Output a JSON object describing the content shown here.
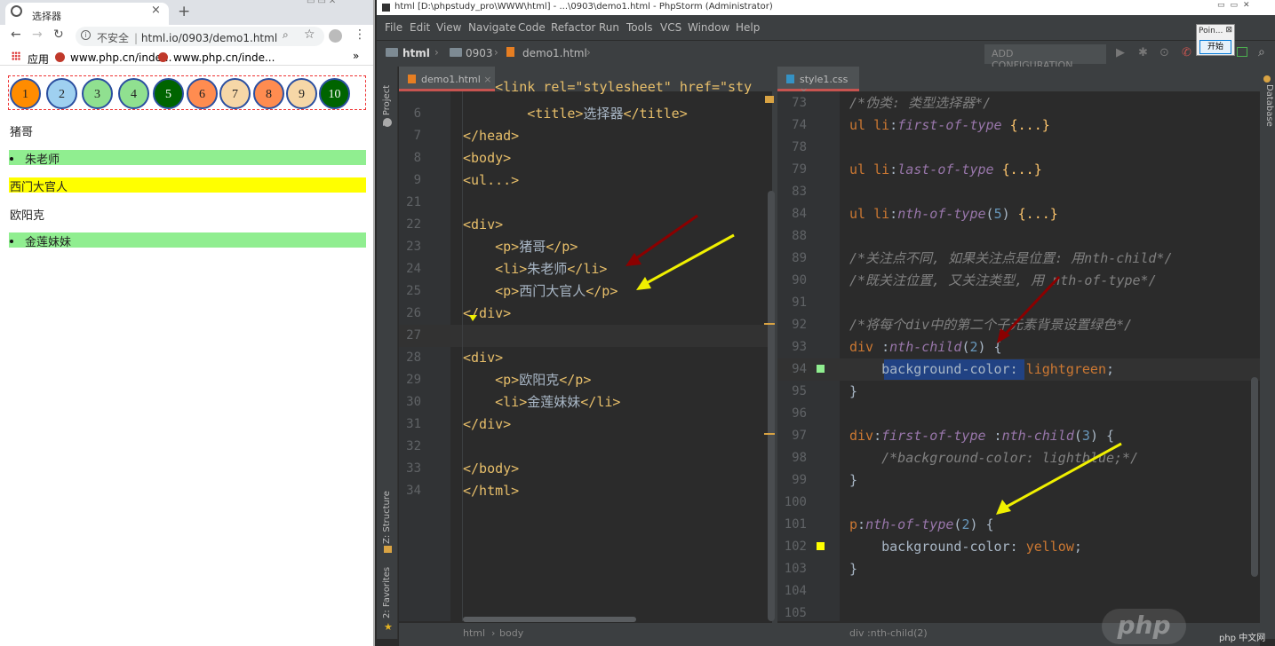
{
  "browser": {
    "tab_title": "选择器",
    "tab_close": "×",
    "new_tab": "+",
    "address_insecure": "不安全",
    "address_url": "html.io/0903/demo1.html",
    "bookmarks": [
      "应用",
      "www.php.cn/inde...",
      "www.php.cn/inde..."
    ],
    "bookmarks_more": "»",
    "circles": [
      {
        "label": "1",
        "bg": "#ff8c00"
      },
      {
        "label": "2",
        "bg": "#9fd0f0"
      },
      {
        "label": "3",
        "bg": "#90e090"
      },
      {
        "label": "4",
        "bg": "#90e090"
      },
      {
        "label": "5",
        "bg": "#006400"
      },
      {
        "label": "6",
        "bg": "#ff8c50"
      },
      {
        "label": "7",
        "bg": "#f6d7a7"
      },
      {
        "label": "8",
        "bg": "#ff8c50"
      },
      {
        "label": "9",
        "bg": "#f6d7a7"
      },
      {
        "label": "10",
        "bg": "#006400"
      }
    ],
    "paragraphs": [
      {
        "text": "猪哥",
        "bg": "",
        "bullet": false
      },
      {
        "text": "朱老师",
        "bg": "#90ee90",
        "bullet": true
      },
      {
        "text": "西门大官人",
        "bg": "#ffff00",
        "bullet": false
      },
      {
        "text": "欧阳克",
        "bg": "",
        "bullet": false
      },
      {
        "text": "金莲妹妹",
        "bg": "#90ee90",
        "bullet": true
      }
    ]
  },
  "ide": {
    "window_title": "html [D:\\phpstudy_pro\\WWW\\html] - ...\\0903\\demo1.html - PhpStorm (Administrator)",
    "menu": [
      "File",
      "Edit",
      "View",
      "Navigate",
      "Code",
      "Refactor",
      "Run",
      "Tools",
      "VCS",
      "Window",
      "Help"
    ],
    "breadcrumb": [
      "html",
      "0903",
      "demo1.html"
    ],
    "add_configuration": "ADD CONFIGURATION...",
    "left_tools": [
      "1: Project",
      "Z: Structure",
      "2: Favorites"
    ],
    "right_tool": "Database",
    "tab1": "demo1.html",
    "tab2": "style1.css",
    "popup_title": "Poin...",
    "popup_button": "开始",
    "status_left": [
      "html",
      "body"
    ],
    "status_right": "div :nth-child(2)",
    "watermark": "php",
    "watermark_small": "php 中文网"
  },
  "editor1_lines": [
    {
      "ln": "6",
      "html": "        <span class='tg'>&lt;title&gt;</span>选择器<span class='tg'>&lt;/title&gt;</span>"
    },
    {
      "ln": "7",
      "html": "<span class='tg'>&lt;/head&gt;</span>"
    },
    {
      "ln": "8",
      "html": "<span class='tg'>&lt;body&gt;</span>"
    },
    {
      "ln": "9",
      "html": "<span class='tg'>&lt;ul...&gt;</span>"
    },
    {
      "ln": "21",
      "html": ""
    },
    {
      "ln": "22",
      "html": "<span class='tg'>&lt;div&gt;</span>"
    },
    {
      "ln": "23",
      "html": "    <span class='tg'>&lt;p&gt;</span>猪哥<span class='tg'>&lt;/p&gt;</span>"
    },
    {
      "ln": "24",
      "html": "    <span class='tg'>&lt;li&gt;</span>朱老师<span class='tg'>&lt;/li&gt;</span>"
    },
    {
      "ln": "25",
      "html": "    <span class='tg'>&lt;p&gt;</span>西门大官人<span class='tg'>&lt;/p&gt;</span>"
    },
    {
      "ln": "26",
      "html": "<span class='tg'>&lt;/div&gt;</span>"
    },
    {
      "ln": "27",
      "html": ""
    },
    {
      "ln": "28",
      "html": "<span class='tg'>&lt;div&gt;</span>"
    },
    {
      "ln": "29",
      "html": "    <span class='tg'>&lt;p&gt;</span>欧阳克<span class='tg'>&lt;/p&gt;</span>"
    },
    {
      "ln": "30",
      "html": "    <span class='tg'>&lt;li&gt;</span>金莲妹妹<span class='tg'>&lt;/li&gt;</span>"
    },
    {
      "ln": "31",
      "html": "<span class='tg'>&lt;/div&gt;</span>"
    },
    {
      "ln": "32",
      "html": ""
    },
    {
      "ln": "33",
      "html": "<span class='tg'>&lt;/body&gt;</span>"
    },
    {
      "ln": "34",
      "html": "<span class='tg'>&lt;/html&gt;</span>"
    }
  ],
  "editor2_lines": [
    {
      "ln": "73",
      "html": "<span class='cm'>/*伪类: 类型选择器*/</span>"
    },
    {
      "ln": "74",
      "html": "<span class='sel'>ul li</span>:<span class='fn'>first-of-type</span> <span class='val'>{...}</span>"
    },
    {
      "ln": "78",
      "html": ""
    },
    {
      "ln": "79",
      "html": "<span class='sel'>ul li</span>:<span class='fn'>last-of-type</span> <span class='val'>{...}</span>"
    },
    {
      "ln": "83",
      "html": ""
    },
    {
      "ln": "84",
      "html": "<span class='sel'>ul li</span>:<span class='fn'>nth-of-type</span>(<span class='num'>5</span>) <span class='val'>{...}</span>"
    },
    {
      "ln": "88",
      "html": ""
    },
    {
      "ln": "89",
      "html": "<span class='cm'>/*关注点不同, 如果关注点是位置: 用nth-child*/</span>"
    },
    {
      "ln": "90",
      "html": "<span class='cm'>/*既关注位置, 又关注类型, 用 nth-of-type*/</span>"
    },
    {
      "ln": "91",
      "html": ""
    },
    {
      "ln": "92",
      "html": "<span class='cm'>/*将每个div中的第二个子元素背景设置绿色*/</span>"
    },
    {
      "ln": "93",
      "html": "<span class='sel'>div</span> :<span class='fn'>nth-child</span>(<span class='num'>2</span>) {"
    },
    {
      "ln": "94",
      "html": "    background-color: <span class='sel'>lightgreen</span>;"
    },
    {
      "ln": "95",
      "html": "}"
    },
    {
      "ln": "96",
      "html": ""
    },
    {
      "ln": "97",
      "html": "<span class='sel'>div</span>:<span class='fn'>first-of-type</span> :<span class='fn'>nth-child</span>(<span class='num'>3</span>) {"
    },
    {
      "ln": "98",
      "html": "    <span class='cm'>/*background-color: lightblue;*/</span>"
    },
    {
      "ln": "99",
      "html": "}"
    },
    {
      "ln": "100",
      "html": ""
    },
    {
      "ln": "101",
      "html": "<span class='sel'>p</span>:<span class='fn'>nth-of-type</span>(<span class='num'>2</span>) {"
    },
    {
      "ln": "102",
      "html": "    background-color: <span class='sel'>yellow</span>;"
    },
    {
      "ln": "103",
      "html": "}"
    },
    {
      "ln": "104",
      "html": ""
    },
    {
      "ln": "105",
      "html": ""
    }
  ]
}
